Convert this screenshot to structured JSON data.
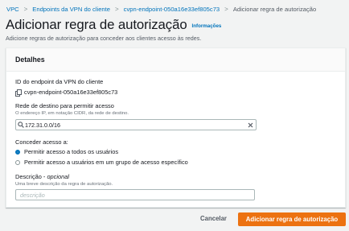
{
  "breadcrumb": {
    "items": [
      "VPC",
      "Endpoints da VPN do cliente",
      "cvpn-endpoint-050a16e33ef805c73",
      "Adicionar regra de autorização"
    ]
  },
  "header": {
    "title": "Adicionar regra de autorização",
    "info_link": "Informações",
    "subtitle": "Adicione regras de autorização para conceder aos clientes acesso às redes."
  },
  "panel": {
    "title": "Detalhes",
    "endpoint_id_label": "ID do endpoint da VPN do cliente",
    "endpoint_id_value": "cvpn-endpoint-050a16e33ef805c73",
    "dest_network_label": "Rede de destino para permitir acesso",
    "dest_network_hint": "O endereço IP, em notação CIDR, da rede de destino.",
    "dest_network_value": "172.31.0.0/16",
    "grant_access_label": "Conceder acesso a:",
    "grant_options": [
      {
        "label": "Permitir acesso a todos os usuários",
        "selected": true
      },
      {
        "label": "Permitir acesso a usuários em um grupo de acesso específico",
        "selected": false
      }
    ],
    "description_label": "Descrição",
    "description_optional": "opcional",
    "description_hint": "Uma breve descrição da regra de autorização.",
    "description_placeholder": "descrição"
  },
  "footer": {
    "cancel_label": "Cancelar",
    "submit_label": "Adicionar regra de autorização"
  },
  "colors": {
    "link": "#0073bb",
    "primary_button": "#ec7211",
    "background": "#f2f3f3"
  }
}
